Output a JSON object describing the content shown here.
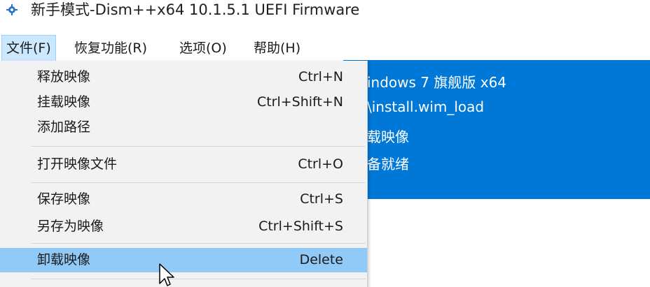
{
  "window": {
    "title": "新手模式-Dism++x64 10.1.5.1 UEFI Firmware",
    "icon": "gear-icon"
  },
  "menubar": {
    "items": [
      {
        "label": "文件(F)",
        "active": true
      },
      {
        "label": "恢复功能(R)",
        "active": false
      },
      {
        "label": "选项(O)",
        "active": false
      },
      {
        "label": "帮助(H)",
        "active": false
      }
    ]
  },
  "file_menu": {
    "items": [
      {
        "label": "释放映像",
        "accel": "Ctrl+N"
      },
      {
        "label": "挂载映像",
        "accel": "Ctrl+Shift+N"
      },
      {
        "label": "添加路径",
        "accel": ""
      },
      {
        "label": "打开映像文件",
        "accel": "Ctrl+O"
      },
      {
        "label": "保存映像",
        "accel": "Ctrl+S"
      },
      {
        "label": "另存为映像",
        "accel": "Ctrl+Shift+S"
      },
      {
        "label": "卸载映像",
        "accel": "Delete",
        "highlighted": true
      }
    ]
  },
  "info_panel": {
    "lines": [
      "indows 7 旗舰版 x64",
      "\\install.wim_load",
      "载映像",
      "备就绪"
    ],
    "background": "#0078d7"
  },
  "colors": {
    "accent": "#0078d7",
    "menu_hover": "#91c9f7",
    "menu_bg": "#f2f2f2"
  }
}
